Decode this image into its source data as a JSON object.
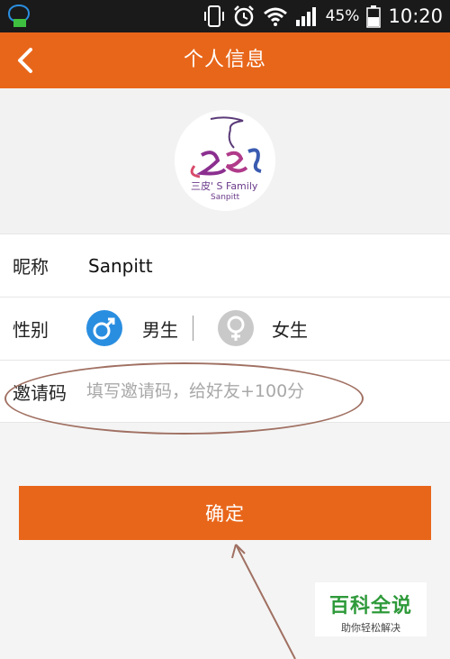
{
  "status_bar": {
    "battery_percent": "45%",
    "time": "10:20",
    "icons": [
      "chat-notification-icon",
      "phone-vibrate-icon",
      "alarm-clock-icon",
      "wifi-icon",
      "signal-icon",
      "battery-icon"
    ]
  },
  "header": {
    "title": "个人信息",
    "back_icon": "chevron-left-icon",
    "background": "#e8661a"
  },
  "profile": {
    "avatar_logo_text": "三皮' S Family",
    "avatar_logo_sub": "Sanpitt"
  },
  "form": {
    "nickname_label": "昵称",
    "nickname_value": "Sanpitt",
    "gender_label": "性别",
    "gender_male": "男生",
    "gender_female": "女生",
    "gender_selected": "男生",
    "invite_label": "邀请码",
    "invite_placeholder": "填写邀请码，给好友+100分",
    "invite_value": ""
  },
  "confirm_label": "确定",
  "watermark": {
    "title": "百科全说",
    "subtitle": "助你轻松解决"
  },
  "colors": {
    "accent": "#e8661a",
    "male": "#2a8ee0",
    "female": "#c9c9c9",
    "annotation": "#a07062"
  }
}
